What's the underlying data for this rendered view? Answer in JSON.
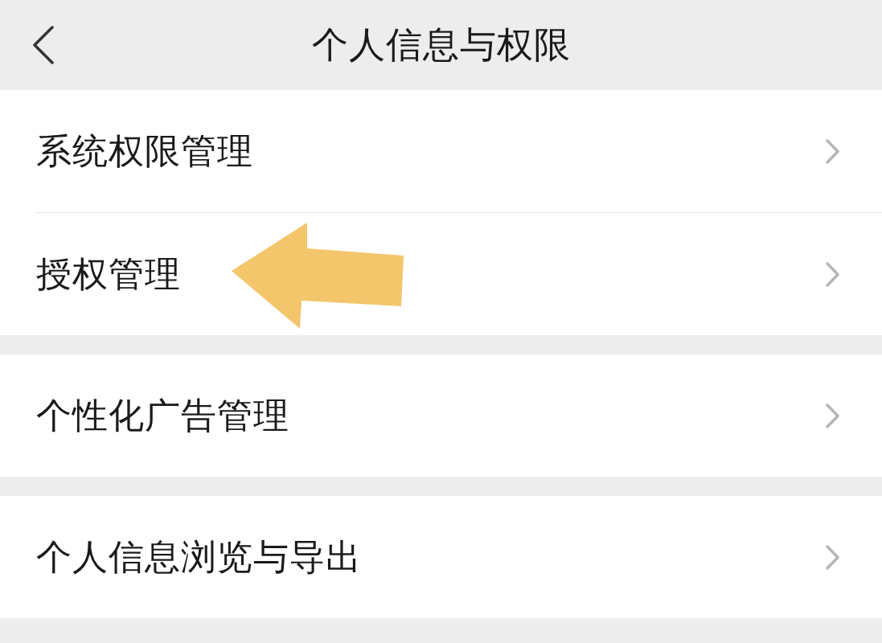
{
  "nav_bar": {
    "title": "个人信息与权限"
  },
  "groups": [
    {
      "items": [
        {
          "label": "系统权限管理",
          "annotated": false
        },
        {
          "label": "授权管理",
          "annotated": true
        }
      ]
    },
    {
      "items": [
        {
          "label": "个性化广告管理",
          "annotated": false
        }
      ]
    },
    {
      "items": [
        {
          "label": "个人信息浏览与导出",
          "annotated": false
        }
      ]
    }
  ]
}
